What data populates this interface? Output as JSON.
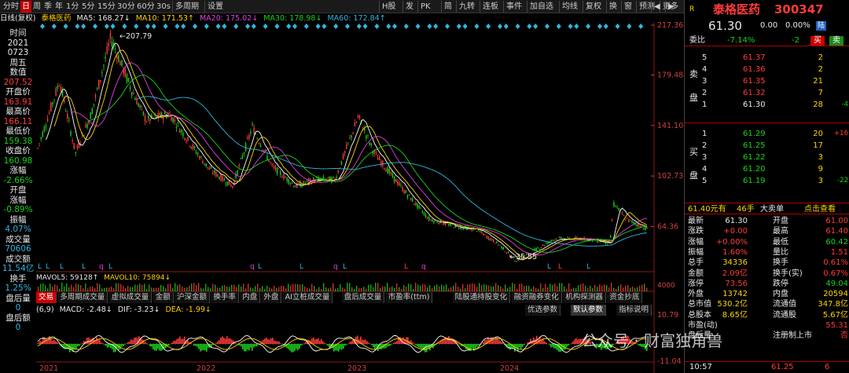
{
  "toolbar": {
    "periods": [
      "分时",
      "日",
      "周",
      "季",
      "年",
      "1分",
      "5分",
      "15分",
      "30分",
      "60分",
      "30s"
    ],
    "active_period": "日",
    "extra": [
      "多周期",
      "设置"
    ],
    "right_items": [
      "H股",
      "发",
      "PK",
      "简",
      "九转",
      "连板",
      "事件",
      "加自选",
      "均线",
      "复权",
      "换",
      "窗",
      "预测",
      "更多"
    ]
  },
  "ma_line": {
    "prefix": "日线(复权)",
    "name": "泰格医药",
    "ma5": "MA5: 168.27↓",
    "ma10": "MA10: 171.53↑",
    "ma20": "MA20: 175.02↓",
    "ma30": "MA30: 178.98↓",
    "ma60": "MA60: 172.84↑"
  },
  "left_info": [
    {
      "t": "时间",
      "c": "white"
    },
    {
      "t": "2021",
      "c": "white"
    },
    {
      "t": "0723",
      "c": "white"
    },
    {
      "t": "周五",
      "c": "white"
    },
    {
      "t": "数值",
      "c": "white"
    },
    {
      "t": "207.52",
      "c": "red"
    },
    {
      "t": "开盘价",
      "c": "white"
    },
    {
      "t": "163.91",
      "c": "red"
    },
    {
      "t": "最高价",
      "c": "white"
    },
    {
      "t": "166.11",
      "c": "red"
    },
    {
      "t": "最低价",
      "c": "white"
    },
    {
      "t": "159.38",
      "c": "green"
    },
    {
      "t": "收盘价",
      "c": "white"
    },
    {
      "t": "160.98",
      "c": "green"
    },
    {
      "t": "涨幅",
      "c": "white"
    },
    {
      "t": "-2.66%",
      "c": "green"
    },
    {
      "t": "开盘",
      "c": "white"
    },
    {
      "t": "涨幅",
      "c": "white"
    },
    {
      "t": "-0.89%",
      "c": "green"
    },
    {
      "t": "振幅",
      "c": "white"
    },
    {
      "t": "4.07%",
      "c": "cyan"
    },
    {
      "t": "成交量",
      "c": "white"
    },
    {
      "t": "70606",
      "c": "cyan"
    },
    {
      "t": "成交额",
      "c": "white"
    },
    {
      "t": "11.54亿",
      "c": "cyan"
    },
    {
      "t": "换手",
      "c": "white"
    },
    {
      "t": "1.25%",
      "c": "cyan"
    },
    {
      "t": "盘后量",
      "c": "white"
    },
    {
      "t": "0",
      "c": "cyan"
    },
    {
      "t": "盘后额",
      "c": "white"
    },
    {
      "t": "0",
      "c": "cyan"
    }
  ],
  "chart": {
    "y_labels": [
      "217.36",
      "179.48",
      "141.10",
      "102.73",
      "64.36"
    ],
    "high_label": "207.79",
    "low_label": "35.55",
    "x_labels": [
      "2021",
      "2022",
      "2023",
      "2024"
    ],
    "vol_line": {
      "mavol5": "MAVOL5: 59128↑",
      "mavol10": "MAVOL10: 75894↓"
    },
    "macd_line": {
      "params": "(6,9)",
      "macd": "MACD: -2.48↓",
      "dif": "DIF: -3.23↓",
      "dea": "DEA: -1.99↓"
    },
    "macd_y": [
      "10.79",
      "-11.04"
    ],
    "vol_y": "4000"
  },
  "indicator_tabs": [
    "交易",
    "多周期成交量",
    "虚拟成交量",
    "金额",
    "沪深金额",
    "换手率",
    "内盘",
    "外盘",
    "AI立桩成交量",
    "盘后成交量",
    "市盈率(ttm)",
    "陆股通持股变化",
    "融资融券变化",
    "机构探测器",
    "资金抄底"
  ],
  "param_buttons": [
    "优选参数",
    "默认参数",
    "指标说明"
  ],
  "right": {
    "tag": "R",
    "name": "泰格医药",
    "code": "300347",
    "price": "61.30",
    "change": "0.00",
    "pct": "0.00%",
    "badge": "陆",
    "weibi_label": "委比",
    "weibi": "-7.14%",
    "weicha": "-2",
    "buy_btn": "买",
    "sell_btn": "卖",
    "sell_side_label": [
      "卖",
      "盘"
    ],
    "buy_side_label": [
      "买",
      "盘"
    ],
    "asks": [
      {
        "lvl": "5",
        "price": "61.37",
        "vol": "2",
        "diff": ""
      },
      {
        "lvl": "4",
        "price": "61.36",
        "vol": "2",
        "diff": ""
      },
      {
        "lvl": "3",
        "price": "61.35",
        "vol": "21",
        "diff": ""
      },
      {
        "lvl": "2",
        "price": "61.32",
        "vol": "7",
        "diff": ""
      },
      {
        "lvl": "1",
        "price": "61.30",
        "vol": "28",
        "diff": "-4"
      }
    ],
    "bids": [
      {
        "lvl": "1",
        "price": "61.29",
        "vol": "20",
        "diff": "+16"
      },
      {
        "lvl": "2",
        "price": "61.25",
        "vol": "17",
        "diff": ""
      },
      {
        "lvl": "3",
        "price": "61.22",
        "vol": "3",
        "diff": ""
      },
      {
        "lvl": "4",
        "price": "61.20",
        "vol": "9",
        "diff": ""
      },
      {
        "lvl": "5",
        "price": "61.19",
        "vol": "3",
        "diff": "-22"
      }
    ],
    "bigorder": {
      "price": "61.40元有",
      "vol": "46手",
      "label": "大卖单",
      "link": "点击查看"
    },
    "stats": [
      [
        "最新",
        "61.30",
        "开盘",
        "61.00"
      ],
      [
        "涨跌",
        "+0.00",
        "最高",
        "61.40"
      ],
      [
        "涨幅",
        "+0.00%",
        "最低",
        "60.42"
      ],
      [
        "振幅",
        "1.60%",
        "量比",
        "1.51"
      ],
      [
        "总手",
        "34336",
        "换手",
        "0.61%"
      ],
      [
        "金额",
        "2.09亿",
        "换手(实)",
        "0.67%"
      ],
      [
        "涨停",
        "73.56",
        "跌停",
        "49.04"
      ],
      [
        "外盘",
        "13742",
        "内盘",
        "20594"
      ],
      [
        "总市值",
        "530.2亿",
        "流通值",
        "347.8亿"
      ],
      [
        "总股本",
        "8.65亿",
        "流通股",
        "5.67亿"
      ],
      [
        "市盈(动)",
        "",
        "",
        "55.31"
      ],
      [
        "盘后量",
        "",
        "注册制上市",
        "否"
      ]
    ],
    "time_row": {
      "time": "10:57",
      "price": "61.25",
      "vol": "6"
    }
  },
  "watermark": "公众号 · 财富独角兽",
  "colors": {
    "up": "#ff3b3b",
    "down": "#19d319",
    "bg": "#000000",
    "ma_yellow": "#ffd400",
    "ma_purple": "#e040e0",
    "ma_green": "#19d319",
    "ma_white": "#ffffff",
    "ma_cyan": "#2fb7e0"
  }
}
